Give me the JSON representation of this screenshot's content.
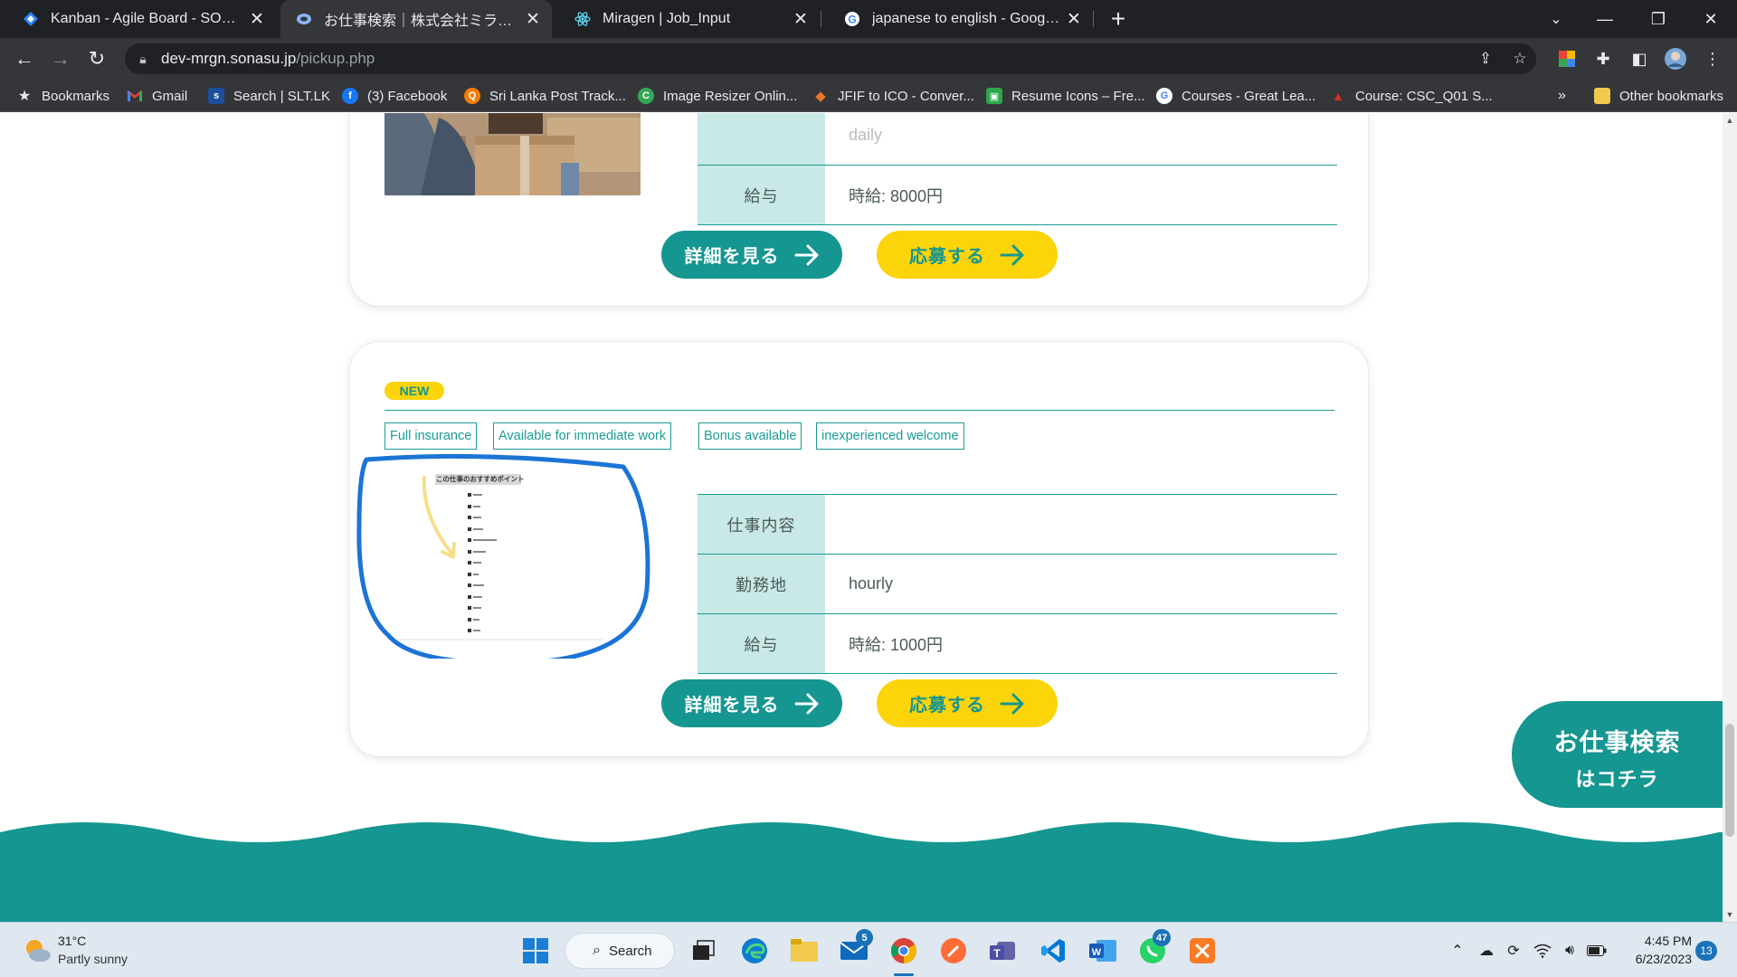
{
  "browser": {
    "tabs": [
      {
        "title": "Kanban - Agile Board - SONASU",
        "icon": "jira-icon",
        "color": "#2684ff"
      },
      {
        "title": "お仕事検索｜株式会社ミラゲン",
        "icon": "site-icon",
        "color": "#8ab4f8"
      },
      {
        "title": "Miragen | Job_Input",
        "icon": "react-icon",
        "color": "#61dafb"
      },
      {
        "title": "japanese to english - Google Sea",
        "icon": "google-icon",
        "color": "#4285f4"
      }
    ],
    "address": {
      "host": "dev-mrgn.sonasu.jp",
      "path": "/pickup.php"
    },
    "bookmarks": [
      {
        "label": "Bookmarks",
        "icon": "star-icon"
      },
      {
        "label": "Gmail",
        "icon": "gmail-icon"
      },
      {
        "label": "Search | SLT.LK",
        "icon": "slt-icon"
      },
      {
        "label": "(3) Facebook",
        "icon": "facebook-icon"
      },
      {
        "label": "Sri Lanka Post Track...",
        "icon": "post-icon"
      },
      {
        "label": "Image Resizer Onlin...",
        "icon": "resizer-icon"
      },
      {
        "label": "JFIF to ICO - Conver...",
        "icon": "convert-icon"
      },
      {
        "label": "Resume Icons – Fre...",
        "icon": "resume-icon"
      },
      {
        "label": "Courses - Great Lea...",
        "icon": "google-icon"
      },
      {
        "label": "Course: CSC_Q01 S...",
        "icon": "course-icon"
      }
    ],
    "more_bookmarks": "»",
    "other_bookmarks": "Other bookmarks"
  },
  "page": {
    "job1": {
      "partial_row_value": "daily",
      "salary_label": "給与",
      "salary_value": "時給: 8000円",
      "detail_button": "詳細を見る",
      "apply_button": "応募する"
    },
    "job2": {
      "badge": "NEW",
      "tags": [
        "Full insurance",
        "Available for immediate work",
        "Bonus available",
        "inexperienced welcome"
      ],
      "image_heading": "この仕事のおすすめポイント",
      "rows": [
        {
          "label": "仕事内容",
          "value": ""
        },
        {
          "label": "勤務地",
          "value": "hourly"
        },
        {
          "label": "給与",
          "value": "時給: 1000円"
        }
      ],
      "detail_button": "詳細を見る",
      "apply_button": "応募する"
    },
    "float_button": {
      "line1": "お仕事検索",
      "line2": "はコチラ"
    },
    "colors": {
      "teal": "#159690",
      "yellow": "#fbd40a",
      "label_bg": "#c8e9e6"
    }
  },
  "taskbar": {
    "weather": {
      "temp": "31°C",
      "desc": "Partly sunny"
    },
    "search_label": "Search",
    "mail_badge": "5",
    "whatsapp_badge": "47",
    "clock": {
      "time": "4:45 PM",
      "date": "6/23/2023"
    },
    "notification_count": "13"
  }
}
